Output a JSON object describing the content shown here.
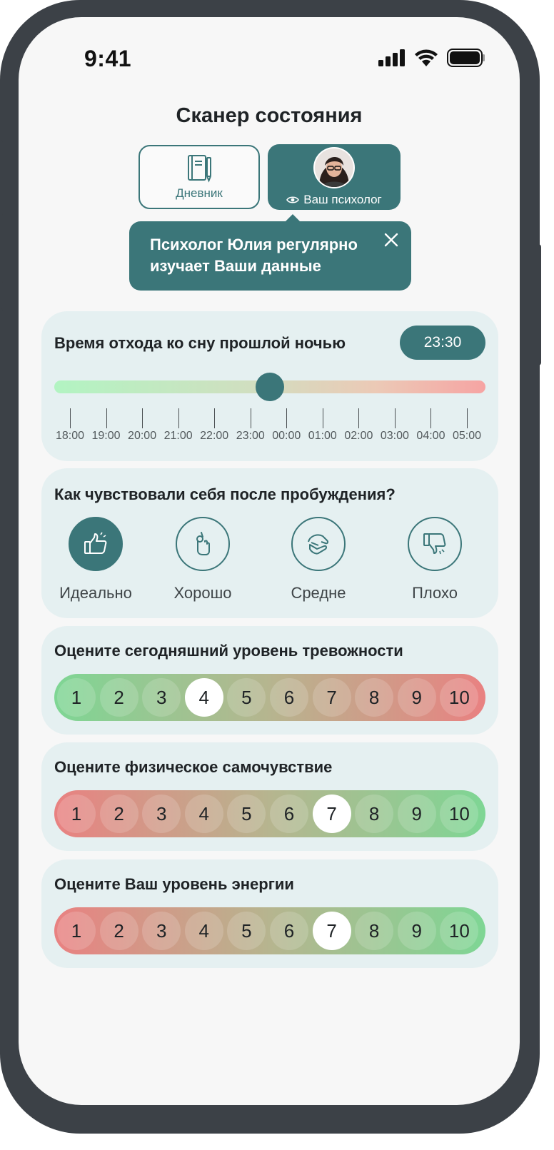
{
  "status": {
    "time": "9:41"
  },
  "title": "Сканер состояния",
  "tabs": {
    "diary": "Дневник",
    "psychologist": "Ваш психолог"
  },
  "tooltip": {
    "text": "Психолог Юлия регулярно изучает Ваши данные"
  },
  "sleep": {
    "title": "Время отхода ко сну прошлой ночью",
    "value": "23:30",
    "ticks": [
      "18:00",
      "19:00",
      "20:00",
      "21:00",
      "22:00",
      "23:00",
      "00:00",
      "01:00",
      "02:00",
      "03:00",
      "04:00",
      "05:00"
    ]
  },
  "wake": {
    "title": "Как чувствовали себя после пробуждения?",
    "options": [
      {
        "label": "Идеально",
        "icon": "thumbs-up-icon",
        "selected": true
      },
      {
        "label": "Хорошо",
        "icon": "ok-hand-icon",
        "selected": false
      },
      {
        "label": "Средне",
        "icon": "so-so-hand-icon",
        "selected": false
      },
      {
        "label": "Плохо",
        "icon": "thumbs-down-icon",
        "selected": false
      }
    ]
  },
  "anxiety": {
    "title": "Оцените сегодняшний уровень тревожности",
    "values": [
      "1",
      "2",
      "3",
      "4",
      "5",
      "6",
      "7",
      "8",
      "9",
      "10"
    ],
    "selected": "4"
  },
  "physical": {
    "title": "Оцените физическое самочувствие",
    "values": [
      "1",
      "2",
      "3",
      "4",
      "5",
      "6",
      "7",
      "8",
      "9",
      "10"
    ],
    "selected": "7"
  },
  "energy": {
    "title": "Оцените Ваш уровень энергии",
    "values": [
      "1",
      "2",
      "3",
      "4",
      "5",
      "6",
      "7",
      "8",
      "9",
      "10"
    ],
    "selected": "7"
  },
  "colors": {
    "accent": "#3b7679",
    "card": "#e5f0f1",
    "background": "#f7f7f7"
  }
}
